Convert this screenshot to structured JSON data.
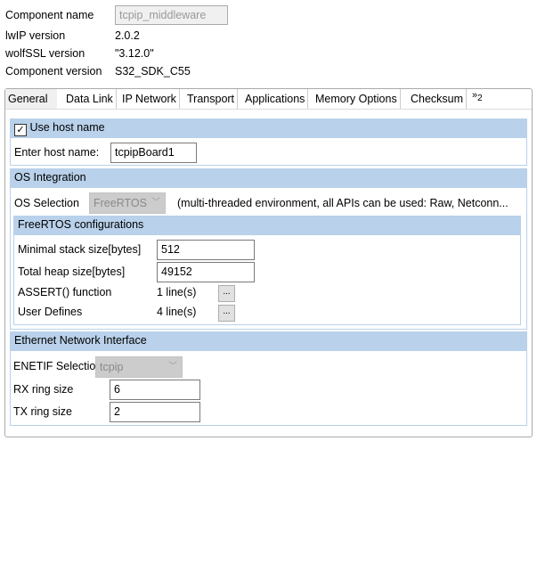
{
  "header": {
    "component_name_label": "Component name",
    "component_name_value": "tcpip_middleware",
    "lwip_label": "lwIP version",
    "lwip_value": "2.0.2",
    "wolfssl_label": "wolfSSL version",
    "wolfssl_value": "\"3.12.0\"",
    "comp_version_label": "Component version",
    "comp_version_value": "S32_SDK_C55"
  },
  "tabs": [
    "General",
    "Data Link",
    "IP Network",
    "Transport",
    "Applications",
    "Memory Options",
    "Checksum"
  ],
  "tabs_overflow": {
    "glyph": "»",
    "count": "2"
  },
  "host": {
    "checkbox_label": "Use host name",
    "checked": true,
    "name_label": "Enter host name:",
    "name_value": "tcpipBoard1"
  },
  "os": {
    "title": "OS Integration",
    "selection_label": "OS Selection",
    "selection_value": "FreeRTOS",
    "description": "(multi-threaded environment, all APIs can be used: Raw, Netconn..."
  },
  "freertos": {
    "title": "FreeRTOS configurations",
    "min_stack_label": "Minimal stack size[bytes]",
    "min_stack_value": "512",
    "heap_label": "Total heap size[bytes]",
    "heap_value": "49152",
    "assert_label": "ASSERT() function",
    "assert_value": "1 line(s)",
    "user_defines_label": "User Defines",
    "user_defines_value": "4 line(s)",
    "ellipsis": "..."
  },
  "ethernet": {
    "title": "Ethernet Network Interface",
    "enetif_label": "ENETIF Selection",
    "enetif_value": "tcpip",
    "rx_label": "RX ring size",
    "rx_value": "6",
    "tx_label": "TX ring size",
    "tx_value": "2"
  }
}
